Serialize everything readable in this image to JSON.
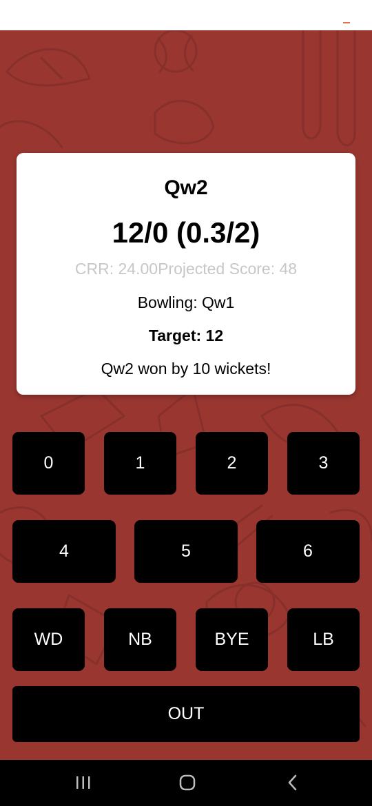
{
  "colors": {
    "background": "#993630",
    "pattern_stroke": "#87302b",
    "card": "#ffffff",
    "button": "#000000",
    "button_text": "#ffffff",
    "muted_text": "#c7c7c7",
    "nav_bar": "#000000",
    "menu_accent": "#e5704f"
  },
  "scorecard": {
    "batting_team": "Qw2",
    "score": "12/0 (0.3/2)",
    "rates_line": "CRR: 24.00Projected Score: 48",
    "bowling": "Bowling: Qw1",
    "target": "Target: 12",
    "result": "Qw2 won by 10 wickets!"
  },
  "keypad": {
    "row1": [
      "0",
      "1",
      "2",
      "3"
    ],
    "row2": [
      "4",
      "5",
      "6"
    ],
    "row3": [
      "WD",
      "NB",
      "BYE",
      "LB"
    ],
    "out": "OUT"
  },
  "navigation": {
    "icons": [
      "recent-apps-icon",
      "home-icon",
      "back-icon"
    ]
  }
}
